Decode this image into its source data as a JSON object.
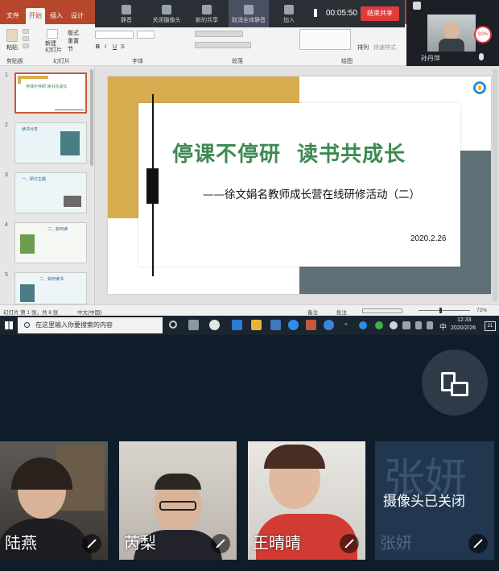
{
  "ppt": {
    "tabs": [
      "文件",
      "开始",
      "插入",
      "设计"
    ],
    "active_tab": "开始",
    "groups": [
      "剪贴板",
      "幻灯片",
      "字体",
      "段落",
      "绘图"
    ],
    "paste_label": "粘贴",
    "new_slide_label": "新建\n幻灯片",
    "layout_label": "版式",
    "reset_label": "重置",
    "section_label": "节",
    "arrange_label": "排列",
    "quick_styles_label": "快速样式"
  },
  "meeting": {
    "buttons": [
      {
        "label": "静音",
        "icon": "mic-icon"
      },
      {
        "label": "关闭摄像头",
        "icon": "camera-icon"
      },
      {
        "label": "新的共享",
        "icon": "share-icon"
      },
      {
        "label": "取消全体静音",
        "icon": "group-icon"
      },
      {
        "label": "加入",
        "icon": "add-user-icon"
      }
    ],
    "timer": "00:05:50",
    "end_share": "结束共享",
    "self_name": "孙丹萍",
    "battery": "92%"
  },
  "slide": {
    "title": "停课不停研  读书共成长",
    "subtitle": "——徐文娟名教师成长营在线研修活动（二）",
    "date": "2020.2.26",
    "colors": {
      "gold": "#d8ad4f",
      "slate": "#5f7176",
      "title_green": "#3e8a52"
    }
  },
  "thumbs": [
    {
      "num": "1",
      "text": "停课不停研  读书共成长"
    },
    {
      "num": "2",
      "text": "读书分享"
    },
    {
      "num": "3",
      "text": "一、研讨主题"
    },
    {
      "num": "4",
      "text": "二、如何读"
    },
    {
      "num": "5",
      "text": "二、如何读书"
    }
  ],
  "status": {
    "slide_info": "幻灯片 第 1 张，共 8 张",
    "language": "中文(中国)",
    "notes": "备注",
    "comments": "批注",
    "zoom": "72%"
  },
  "taskbar": {
    "search_placeholder": "在这里输入你要搜索的内容",
    "ime": "中",
    "time": "12:33",
    "date": "2020/2/26",
    "notif": "21"
  },
  "participants": [
    {
      "name": "陆燕",
      "camera": "on"
    },
    {
      "name": "芮梨",
      "camera": "on"
    },
    {
      "name": "王晴晴",
      "camera": "on"
    },
    {
      "name": "张妍",
      "camera": "off",
      "bg_name": "张妍",
      "off_text": "摄像头已关闭"
    }
  ]
}
